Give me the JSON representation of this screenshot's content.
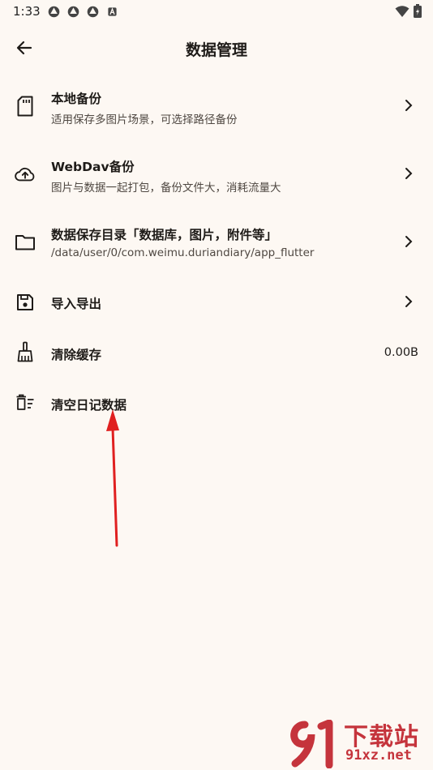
{
  "status_bar": {
    "time": "1:33"
  },
  "header": {
    "title": "数据管理"
  },
  "items": [
    {
      "title": "本地备份",
      "subtitle": "适用保存多图片场景，可选择路径备份",
      "icon": "sd-card-icon",
      "has_chevron": true
    },
    {
      "title": "WebDav备份",
      "subtitle": "图片与数据一起打包，备份文件大，消耗流量大",
      "icon": "cloud-upload-icon",
      "has_chevron": true
    },
    {
      "title": "数据保存目录「数据库，图片，附件等」",
      "subtitle": "/data/user/0/com.weimu.duriandiary/app_flutter",
      "icon": "folder-icon",
      "has_chevron": true
    },
    {
      "title": "导入导出",
      "icon": "save-icon",
      "has_chevron": true
    },
    {
      "title": "清除缓存",
      "value": "0.00B",
      "icon": "broom-icon",
      "has_chevron": false
    },
    {
      "title": "清空日记数据",
      "icon": "delete-sweep-icon",
      "has_chevron": false
    }
  ],
  "watermark": {
    "text_main": "下载站",
    "text_url": "91xz.net"
  },
  "colors": {
    "background": "#fdf8f3",
    "text": "#1e1b18",
    "subtext": "#4f4842",
    "annotation": "#e02020",
    "watermark": "#c5343c"
  }
}
